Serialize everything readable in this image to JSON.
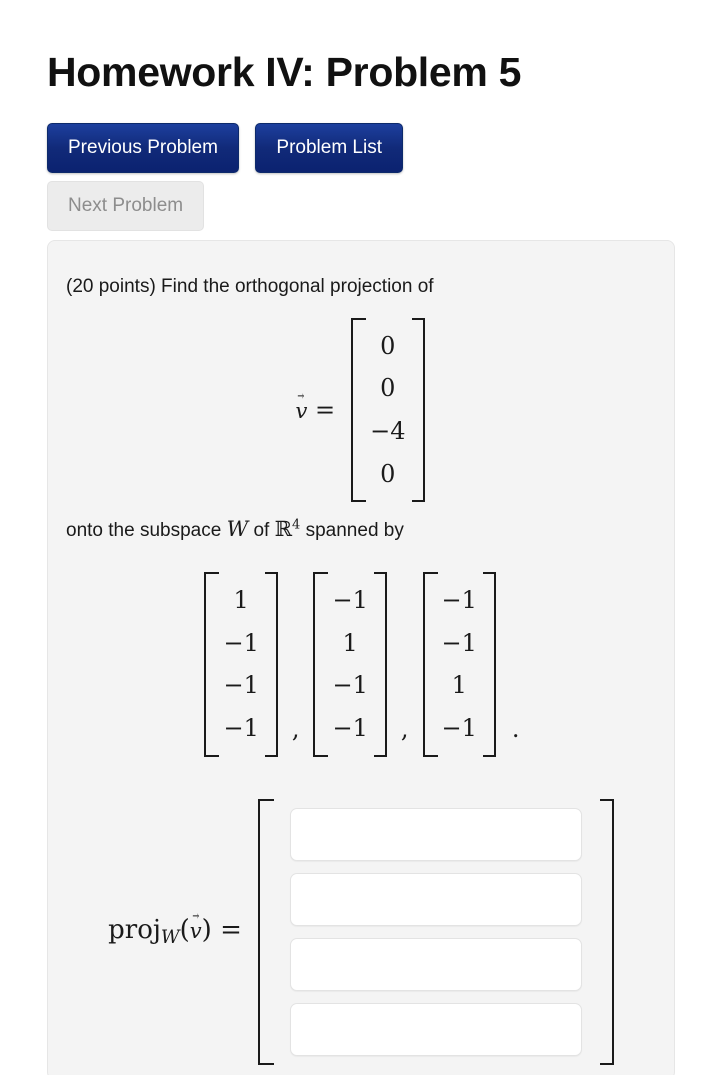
{
  "header": {
    "title": "Homework IV: Problem 5"
  },
  "nav": {
    "previous_label": "Previous Problem",
    "problem_list_label": "Problem List",
    "next_label": "Next Problem",
    "next_disabled": true,
    "button_color": "#112a79",
    "disabled_bg": "#ececec",
    "disabled_text": "#8d8d8d"
  },
  "problem": {
    "points_text": "(20 points) Find the orthogonal projection of",
    "v_symbol": "v",
    "equals": "=",
    "v_vector": [
      "0",
      "0",
      "−4",
      "0"
    ],
    "subspace_text_before": "onto the subspace",
    "subspace_symbol": "W",
    "subspace_text_mid": "of",
    "field_symbol": "ℝ",
    "field_exponent": "4",
    "subspace_text_after": "spanned by",
    "spanning_vectors": [
      [
        "1",
        "−1",
        "−1",
        "−1"
      ],
      [
        "−1",
        "1",
        "−1",
        "−1"
      ],
      [
        "−1",
        "−1",
        "1",
        "−1"
      ]
    ],
    "separator": ",",
    "terminator": "."
  },
  "answer": {
    "label_proj": "proj",
    "label_sub": "W",
    "label_paren_open": "(",
    "label_v": "v",
    "label_paren_close": ")",
    "label_equals": "=",
    "inputs": [
      {
        "value": "",
        "placeholder": ""
      },
      {
        "value": "",
        "placeholder": ""
      },
      {
        "value": "",
        "placeholder": ""
      },
      {
        "value": "",
        "placeholder": ""
      }
    ]
  },
  "theme": {
    "page_bg": "#ffffff",
    "panel_bg": "#f4f4f4",
    "panel_border": "#e6e6e6",
    "text": "#1a1a1a"
  }
}
